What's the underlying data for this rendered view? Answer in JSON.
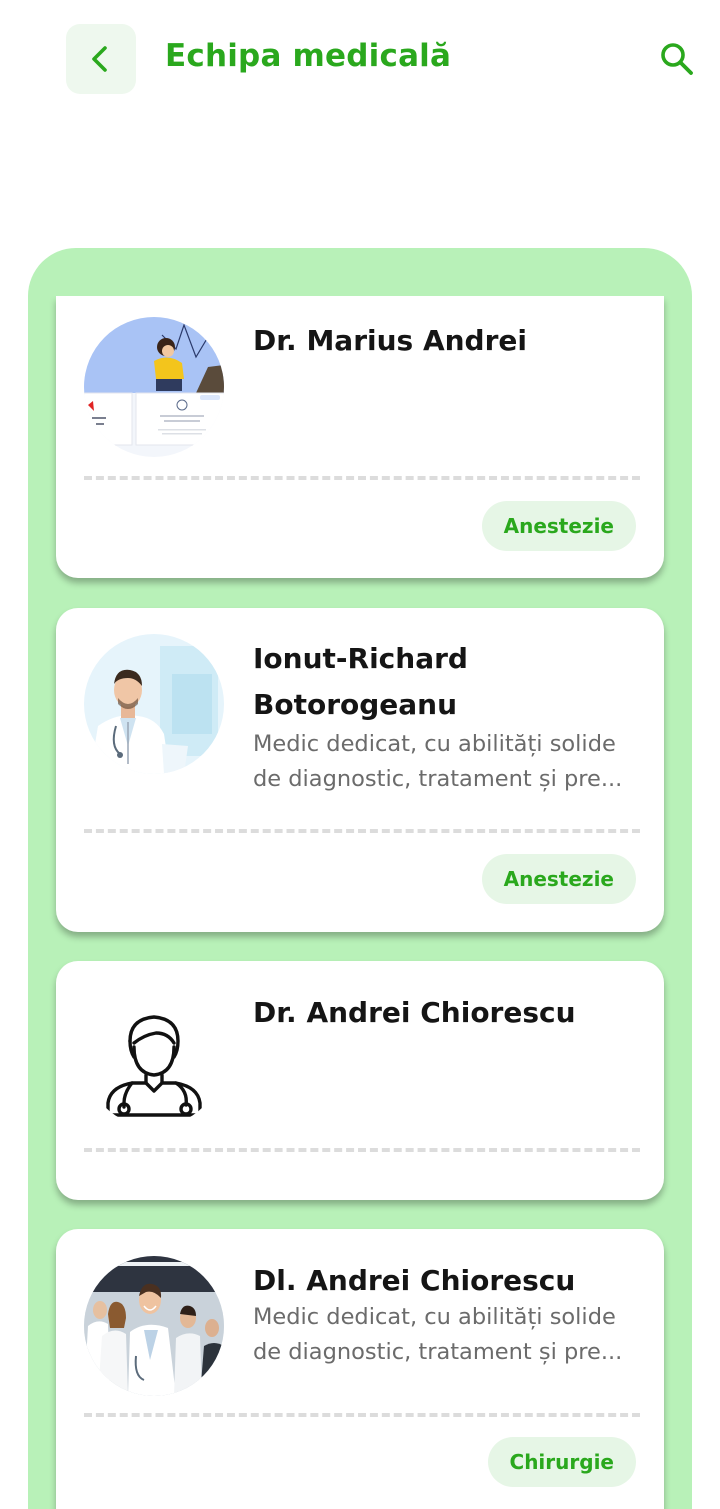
{
  "header": {
    "title": "Echipa medicală",
    "back_icon": "chevron-left-icon",
    "search_icon": "search-icon"
  },
  "colors": {
    "accent": "#2aa81d",
    "panel_bg": "#b8f1b8",
    "tag_bg": "#e6f6e6"
  },
  "doctors": [
    {
      "name": "Dr. Marius Andrei",
      "description_line1": "",
      "description_line2": "",
      "specialty": "Anestezie",
      "avatar": "screenshot-image"
    },
    {
      "name_line1": "Ionut-Richard",
      "name_line2": "Botorogeanu",
      "description_line1": "Medic dedicat, cu abilități solide",
      "description_line2": "de diagnostic, tratament și pre...",
      "specialty": "Anestezie",
      "avatar": "doctor-photo"
    },
    {
      "name": "Dr. Andrei Chiorescu",
      "description_line1": "",
      "description_line2": "",
      "specialty": "",
      "avatar": "doctor-outline-icon"
    },
    {
      "name": "Dl. Andrei Chiorescu",
      "description_line1": "Medic dedicat, cu abilități solide",
      "description_line2": "de diagnostic, tratament și pre...",
      "specialty": "Chirurgie",
      "avatar": "team-photo"
    }
  ]
}
